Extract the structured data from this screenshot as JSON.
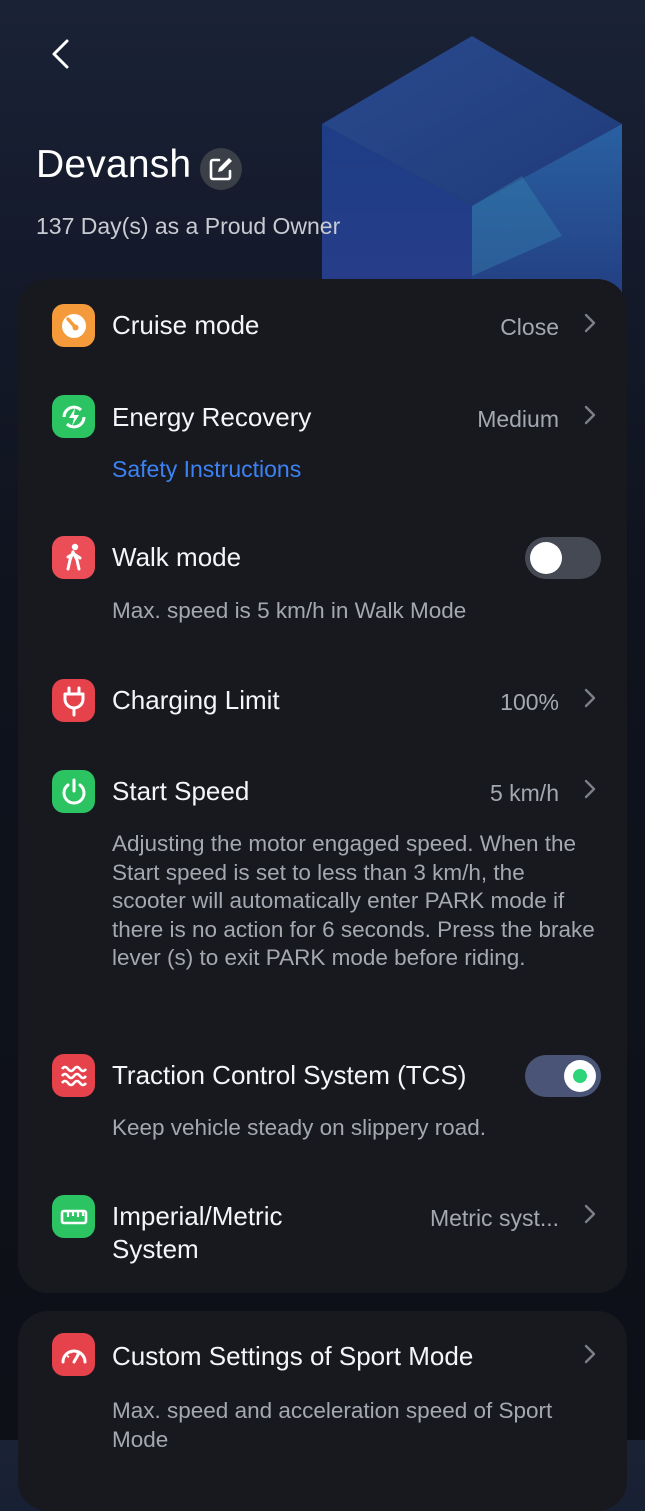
{
  "header": {
    "owner_name": "Devansh",
    "owner_since": "137 Day(s) as a Proud Owner"
  },
  "settings": {
    "cruise": {
      "title": "Cruise mode",
      "value": "Close",
      "icon": "gauge-icon",
      "color": "#f59a3b"
    },
    "energy": {
      "title": "Energy Recovery",
      "value": "Medium",
      "link": "Safety Instructions",
      "icon": "energy-recovery-icon",
      "color": "#2cc462"
    },
    "walk": {
      "title": "Walk mode",
      "desc": "Max. speed is 5 km/h in Walk Mode",
      "enabled": false,
      "icon": "walking-person-icon",
      "color": "#ec4e57"
    },
    "charging": {
      "title": "Charging Limit",
      "value": "100%",
      "icon": "plug-icon",
      "color": "#e6424b"
    },
    "start_speed": {
      "title": "Start Speed",
      "value": "5 km/h",
      "desc": "Adjusting the motor engaged speed. When the Start speed is set to less than 3 km/h, the scooter will automatically enter PARK mode if there is no action for 6 seconds. Press the brake lever (s) to exit PARK mode before riding.",
      "icon": "power-icon",
      "color": "#2cc462"
    },
    "tcs": {
      "title": "Traction Control System (TCS)",
      "desc": "Keep vehicle steady on slippery road.",
      "enabled": true,
      "icon": "waves-icon",
      "color": "#e6424b"
    },
    "units": {
      "title": "Imperial/Metric System",
      "value": "Metric syst...",
      "icon": "ruler-icon",
      "color": "#2cc462"
    },
    "sport": {
      "title": "Custom Settings of Sport Mode",
      "desc": "Max. speed and acceleration speed of Sport Mode",
      "icon": "speedometer-icon",
      "color": "#e6424b"
    }
  }
}
